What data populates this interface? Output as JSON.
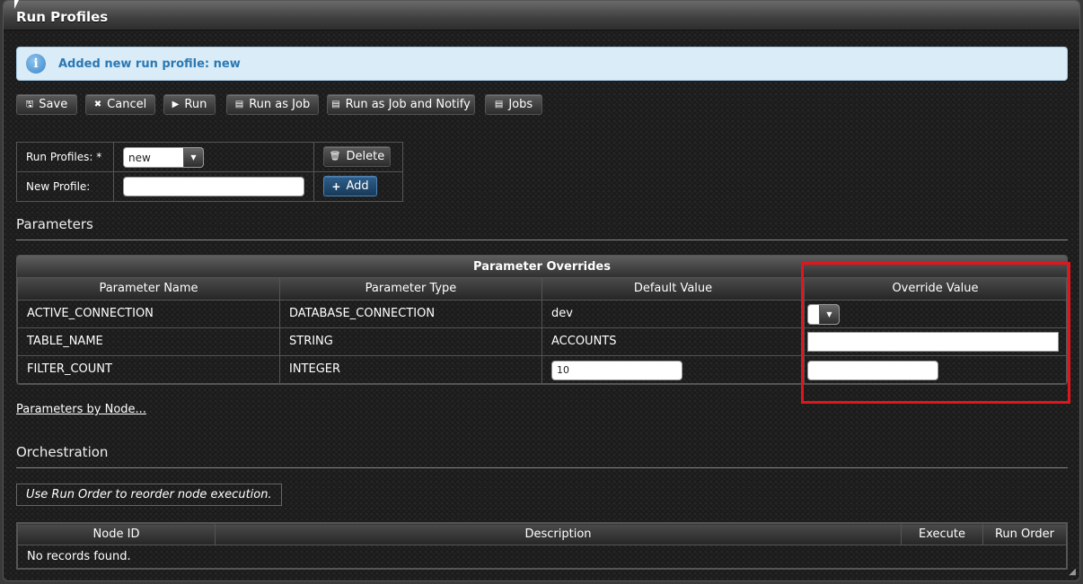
{
  "window": {
    "title": "Run Profiles"
  },
  "message": {
    "icon": "info-icon",
    "text": "Added new run profile: new"
  },
  "toolbar": {
    "save": "Save",
    "cancel": "Cancel",
    "run": "Run",
    "run_as_job": "Run as Job",
    "run_as_job_notify": "Run as Job and Notify",
    "jobs": "Jobs"
  },
  "profile_form": {
    "run_profiles_label": "Run Profiles: *",
    "run_profiles_value": "new",
    "delete_label": "Delete",
    "new_profile_label": "New Profile:",
    "new_profile_value": "",
    "add_label": "Add"
  },
  "parameters": {
    "section_title": "Parameters",
    "table_caption": "Parameter Overrides",
    "columns": [
      "Parameter Name",
      "Parameter Type",
      "Default Value",
      "Override Value"
    ],
    "rows": [
      {
        "name": "ACTIVE_CONNECTION",
        "type": "DATABASE_CONNECTION",
        "default": "dev",
        "override": ""
      },
      {
        "name": "TABLE_NAME",
        "type": "STRING",
        "default": "ACCOUNTS",
        "override": ""
      },
      {
        "name": "FILTER_COUNT",
        "type": "INTEGER",
        "default": "10",
        "override": ""
      }
    ],
    "by_node_link": "Parameters by Node..."
  },
  "orchestration": {
    "section_title": "Orchestration",
    "note": "Use Run Order to reorder node execution.",
    "columns": [
      "Node ID",
      "Description",
      "Execute",
      "Run Order"
    ],
    "empty_text": "No records found."
  },
  "colors": {
    "highlight": "#e0161e",
    "message_bg": "#d9ecf7",
    "message_text": "#2b78b3"
  }
}
